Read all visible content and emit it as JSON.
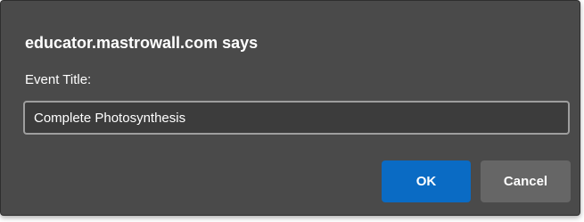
{
  "dialog": {
    "title": "educator.mastrowall.com says",
    "prompt_label": "Event Title:",
    "input_value": "Complete Photosynthesis",
    "ok_label": "OK",
    "cancel_label": "Cancel"
  },
  "colors": {
    "dialog_bg": "#4a4a4a",
    "primary_button": "#0a6bc4",
    "secondary_button": "#666666",
    "input_border": "#9e9e9e"
  }
}
